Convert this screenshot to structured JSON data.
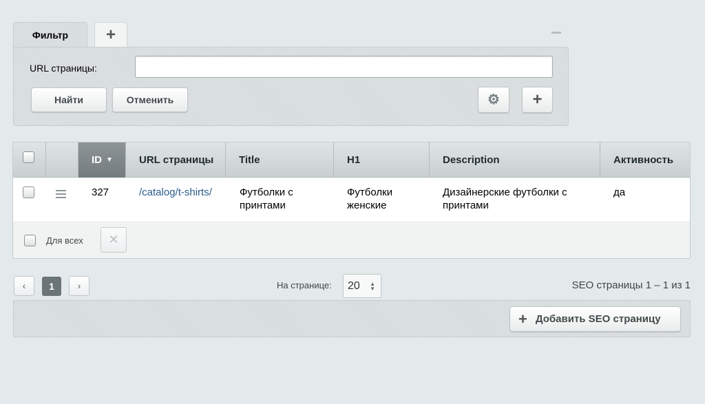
{
  "filter": {
    "tab_label": "Фильтр",
    "add_tab_icon": "+",
    "url_label": "URL страницы:",
    "url_value": "",
    "find_label": "Найти",
    "cancel_label": "Отменить",
    "settings_icon": "⚙",
    "add_field_icon": "+"
  },
  "grid": {
    "columns": [
      {
        "label": "ID",
        "sort": "desc"
      },
      {
        "label": "URL страницы"
      },
      {
        "label": "Title"
      },
      {
        "label": "H1"
      },
      {
        "label": "Description"
      },
      {
        "label": "Активность"
      }
    ],
    "rows": [
      {
        "id": "327",
        "url": "/catalog/t-shirts/",
        "title": "Футболки с принтами",
        "h1": "Футболки женские",
        "description": "Дизайнерские футболки с принтами",
        "active": "да"
      }
    ],
    "for_all_label": "Для всех",
    "delete_icon": "✕"
  },
  "pager": {
    "prev_icon": "‹",
    "current_page": "1",
    "next_icon": "›",
    "per_page_label": "На странице:",
    "per_page_value": "20",
    "info": "SEO страницы 1 – 1 из 1"
  },
  "actions": {
    "add_icon": "+",
    "add_label": "Добавить SEO страницу"
  }
}
